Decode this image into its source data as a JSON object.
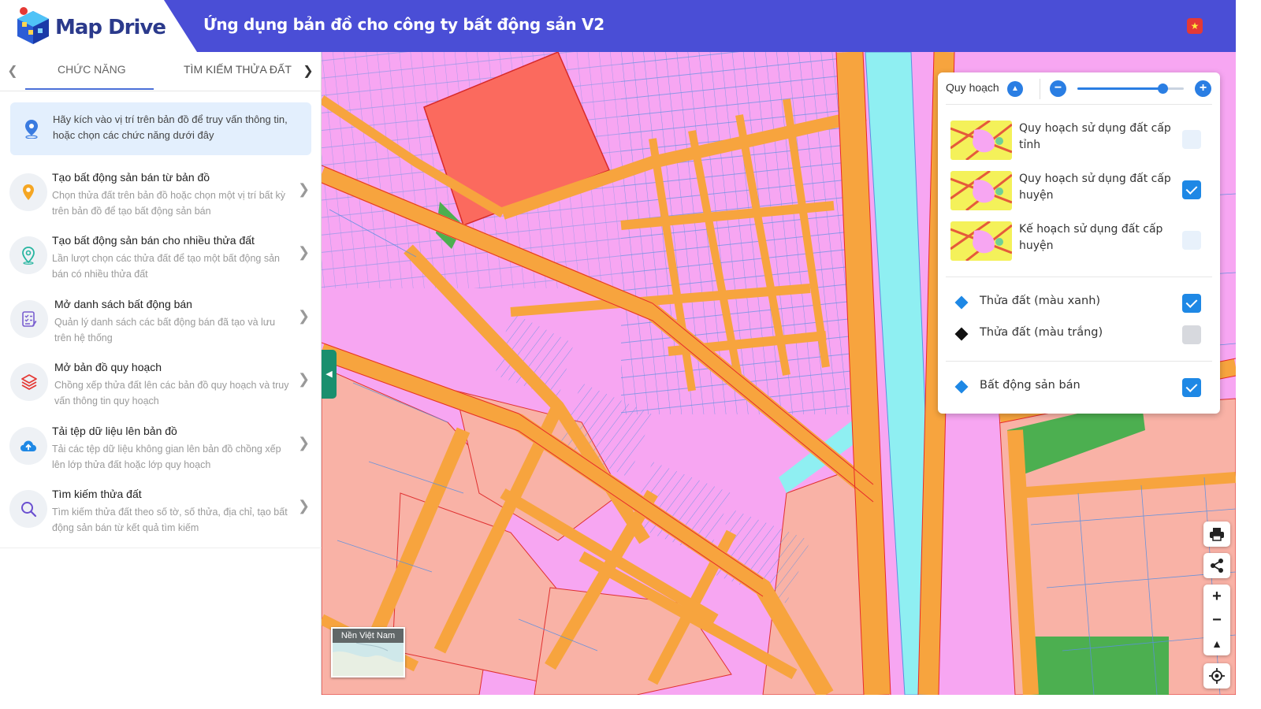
{
  "header": {
    "logo_text": "Map Drive",
    "title": "Ứng dụng bản đồ cho công ty bất động sản V2",
    "flag_icon": "vietnam-flag-icon",
    "colors": {
      "bar": "#4a4ed6",
      "logo": "#2b3a8c"
    }
  },
  "sidebar": {
    "tabs": [
      {
        "label": "CHỨC NĂNG",
        "active": true
      },
      {
        "label": "TÌM KIẾM THỬA ĐẤT",
        "active": false
      }
    ],
    "info": "Hãy kích vào vị trí trên bản đồ để truy vấn thông tin, hoặc chọn các chức năng dưới đây",
    "items": [
      {
        "icon": "map-pin-orange-icon",
        "title": "Tạo bất động sản bán từ bản đồ",
        "desc": "Chọn thửa đất trên bản đồ hoặc chọn một vị trí bất kỳ trên bản đồ để tạo bất động sản bán"
      },
      {
        "icon": "map-pin-outline-teal-icon",
        "title": "Tạo bất động sản bán cho nhiều thửa đất",
        "desc": "Lần lượt chọn các thửa đất để tạo một bất động sản bán có nhiều thửa đất"
      },
      {
        "icon": "checklist-icon",
        "title": "Mở danh sách bất động bán",
        "desc": "Quản lý danh sách các bất động bán đã tạo và lưu trên hệ thống"
      },
      {
        "icon": "layers-icon",
        "title": "Mở bản đồ quy hoạch",
        "desc": "Chồng xếp thửa đất lên các bản đồ quy hoạch và truy vấn thông tin quy hoạch"
      },
      {
        "icon": "cloud-upload-icon",
        "title": "Tải tệp dữ liệu lên bản đồ",
        "desc": "Tải các tệp dữ liệu không gian lên bản đồ chồng xếp lên lớp thửa đất hoặc lớp quy hoạch"
      },
      {
        "icon": "search-icon",
        "title": "Tìm kiếm thửa đất",
        "desc": "Tìm kiếm thửa đất theo số tờ, số thửa, địa chỉ, tạo bất động sản bán từ kết quả tìm kiếm"
      }
    ]
  },
  "layer_panel": {
    "title": "Quy hoạch",
    "opacity_fraction": 0.8,
    "plans": [
      {
        "label": "Quy hoạch sử dụng đất cấp tỉnh",
        "checked": false
      },
      {
        "label": "Quy hoạch sử dụng đất cấp huyện",
        "checked": true
      },
      {
        "label": "Kế hoạch sử dụng đất cấp huyện",
        "checked": false
      }
    ],
    "layers": [
      {
        "label": "Thửa đất (màu xanh)",
        "checked": true,
        "color": "#1e88e5"
      },
      {
        "label": "Thửa đất (màu trắng)",
        "checked": false,
        "color": "#111111"
      },
      {
        "label": "Bất động sản bán",
        "checked": true,
        "color": "#1e88e5"
      }
    ]
  },
  "basemap": {
    "label": "Nền Việt Nam"
  },
  "map_controls": [
    "print-icon",
    "share-icon",
    "zoom-in-icon",
    "zoom-out-icon",
    "compass-icon",
    "locate-icon"
  ],
  "map_colors": {
    "residential": "#f7a6f2",
    "road": "#f7a43e",
    "commercial": "#fb6a5e",
    "mixed": "#f9b2a6",
    "water": "#8feff2",
    "green": "#4caf50",
    "parcel_lines": "#5a8fe0"
  }
}
